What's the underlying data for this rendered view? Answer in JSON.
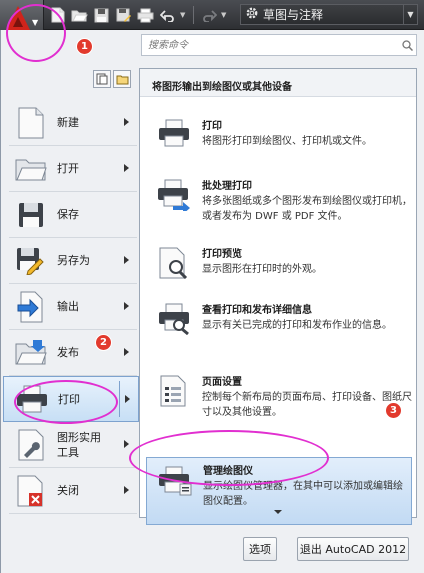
{
  "titlebar": {
    "workspace": "草图与注释"
  },
  "search": {
    "placeholder": "搜索命令"
  },
  "left_menu": {
    "items": [
      {
        "label": "新建"
      },
      {
        "label": "打开"
      },
      {
        "label": "保存"
      },
      {
        "label": "另存为"
      },
      {
        "label": "输出"
      },
      {
        "label": "发布"
      },
      {
        "label": "打印"
      },
      {
        "label": "图形实用\n工具"
      },
      {
        "label": "关闭"
      }
    ]
  },
  "panel": {
    "title": "将图形输出到绘图仪或其他设备",
    "items": [
      {
        "title": "打印",
        "desc": "将图形打印到绘图仪、打印机或文件。"
      },
      {
        "title": "批处理打印",
        "desc": "将多张图纸或多个图形发布到绘图仪或打印机，或者发布为 DWF 或 PDF 文件。"
      },
      {
        "title": "打印预览",
        "desc": "显示图形在打印时的外观。"
      },
      {
        "title": "查看打印和发布详细信息",
        "desc": "显示有关已完成的打印和发布作业的信息。"
      },
      {
        "title": "页面设置",
        "desc": "控制每个新布局的页面布局、打印设备、图纸尺寸以及其他设置。"
      },
      {
        "title": "管理绘图仪",
        "desc": "显示绘图仪管理器，在其中可以添加或编辑绘图仪配置。"
      }
    ]
  },
  "buttons": {
    "options": "选项",
    "exit": "退出 AutoCAD 2012"
  },
  "annotations": {
    "n1": "1",
    "n2": "2",
    "n3": "3",
    "marker_color": "#e12fd0",
    "badge_color": "#e23a2d"
  }
}
